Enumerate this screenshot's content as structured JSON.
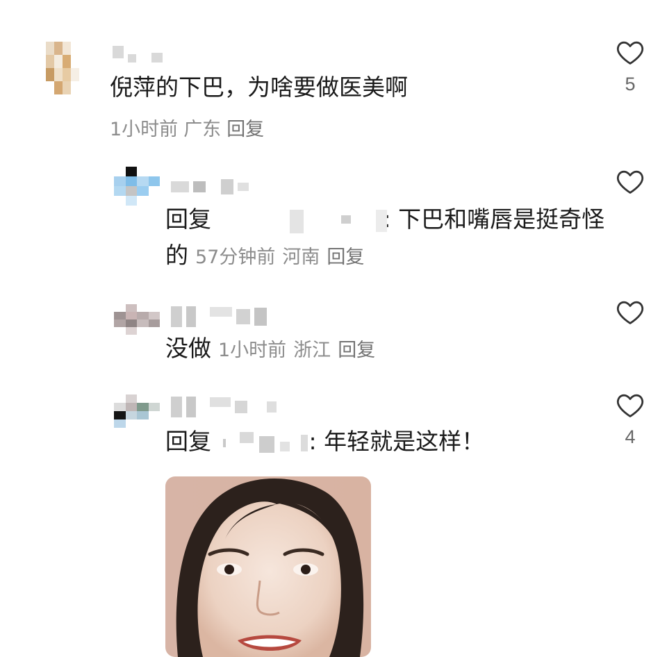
{
  "comments": [
    {
      "text": "倪萍的下巴，为啥要做医美啊",
      "time": "1小时前",
      "location": "广东",
      "reply_label": "回复",
      "likes": "5"
    },
    {
      "prefix": "回复",
      "text": ": 下巴和嘴唇是挺奇怪",
      "text_cont": "的",
      "time": "57分钟前",
      "location": "河南",
      "reply_label": "回复",
      "likes": ""
    },
    {
      "text": "没做",
      "time": "1小时前",
      "location": "浙江",
      "reply_label": "回复",
      "likes": ""
    },
    {
      "prefix": "回复",
      "text": ": 年轻就是这样！",
      "likes": "4"
    }
  ],
  "icons": {
    "like": "heart-outline-icon"
  },
  "colors": {
    "text": "#1a1a1a",
    "meta": "#8c8c8c"
  }
}
